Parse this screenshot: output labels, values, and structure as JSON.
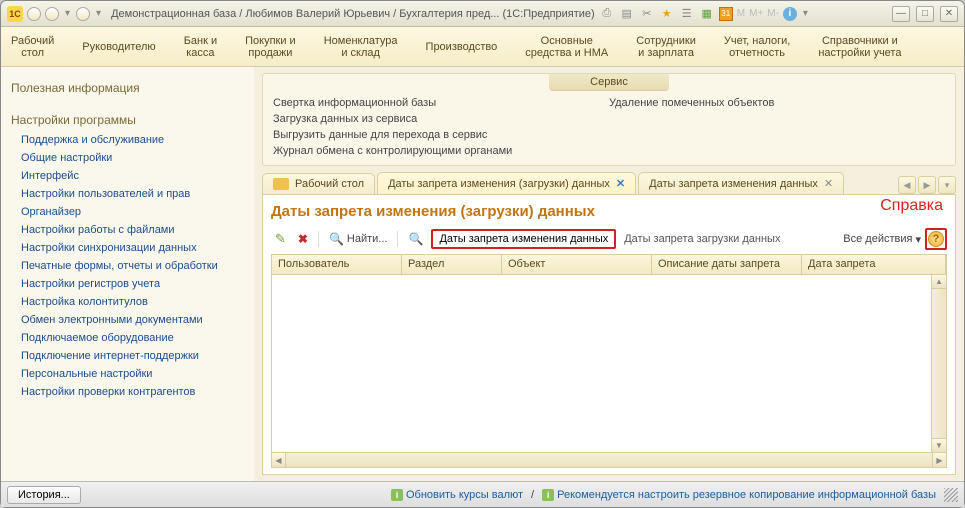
{
  "titlebar": {
    "title": "Демонстрационная база / Любимов Валерий Юрьевич / Бухгалтерия пред... (1С:Предприятие)",
    "cal": "31"
  },
  "topnav": [
    "Рабочий\nстол",
    "Руководителю",
    "Банк и\nкасса",
    "Покупки и\nпродажи",
    "Номенклатура\nи склад",
    "Производство",
    "Основные\nсредства и НМА",
    "Сотрудники\nи зарплата",
    "Учет, налоги,\nотчетность",
    "Справочники и\nнастройки учета"
  ],
  "sidebar": {
    "h1": "Полезная информация",
    "h2": "Настройки программы",
    "links": [
      "Поддержка и обслуживание",
      "Общие настройки",
      "Интерфейс",
      "Настройки пользователей и прав",
      "Органайзер",
      "Настройки работы с файлами",
      "Настройки синхронизации данных",
      "Печатные формы, отчеты и обработки",
      "Настройки регистров учета",
      "Настройка колонтитулов",
      "Обмен электронными документами",
      "Подключаемое оборудование",
      "Подключение интернет-поддержки",
      "Персональные настройки",
      "Настройки проверки контрагентов"
    ]
  },
  "service": {
    "title": "Сервис",
    "left": [
      "Свертка информационной базы",
      "Загрузка данных из сервиса",
      "Выгрузить данные для перехода в сервис",
      "Журнал обмена с контролирующими органами"
    ],
    "right": [
      "Удаление помеченных объектов"
    ]
  },
  "tabs": {
    "t0": "Рабочий стол",
    "t1": "Даты запрета изменения (загрузки) данных",
    "t2": "Даты запрета изменения данных"
  },
  "page": {
    "title": "Даты запрета изменения (загрузки) данных",
    "help": "Справка",
    "find": "Найти...",
    "btn1": "Даты запрета изменения данных",
    "btn2": "Даты запрета загрузки данных",
    "allactions": "Все действия"
  },
  "columns": {
    "c1": "Пользователь",
    "c2": "Раздел",
    "c3": "Объект",
    "c4": "Описание даты запрета",
    "c5": "Дата запрета"
  },
  "status": {
    "history": "История...",
    "s1": "Обновить курсы валют",
    "s2": "Рекомендуется настроить резервное копирование информационной базы"
  }
}
